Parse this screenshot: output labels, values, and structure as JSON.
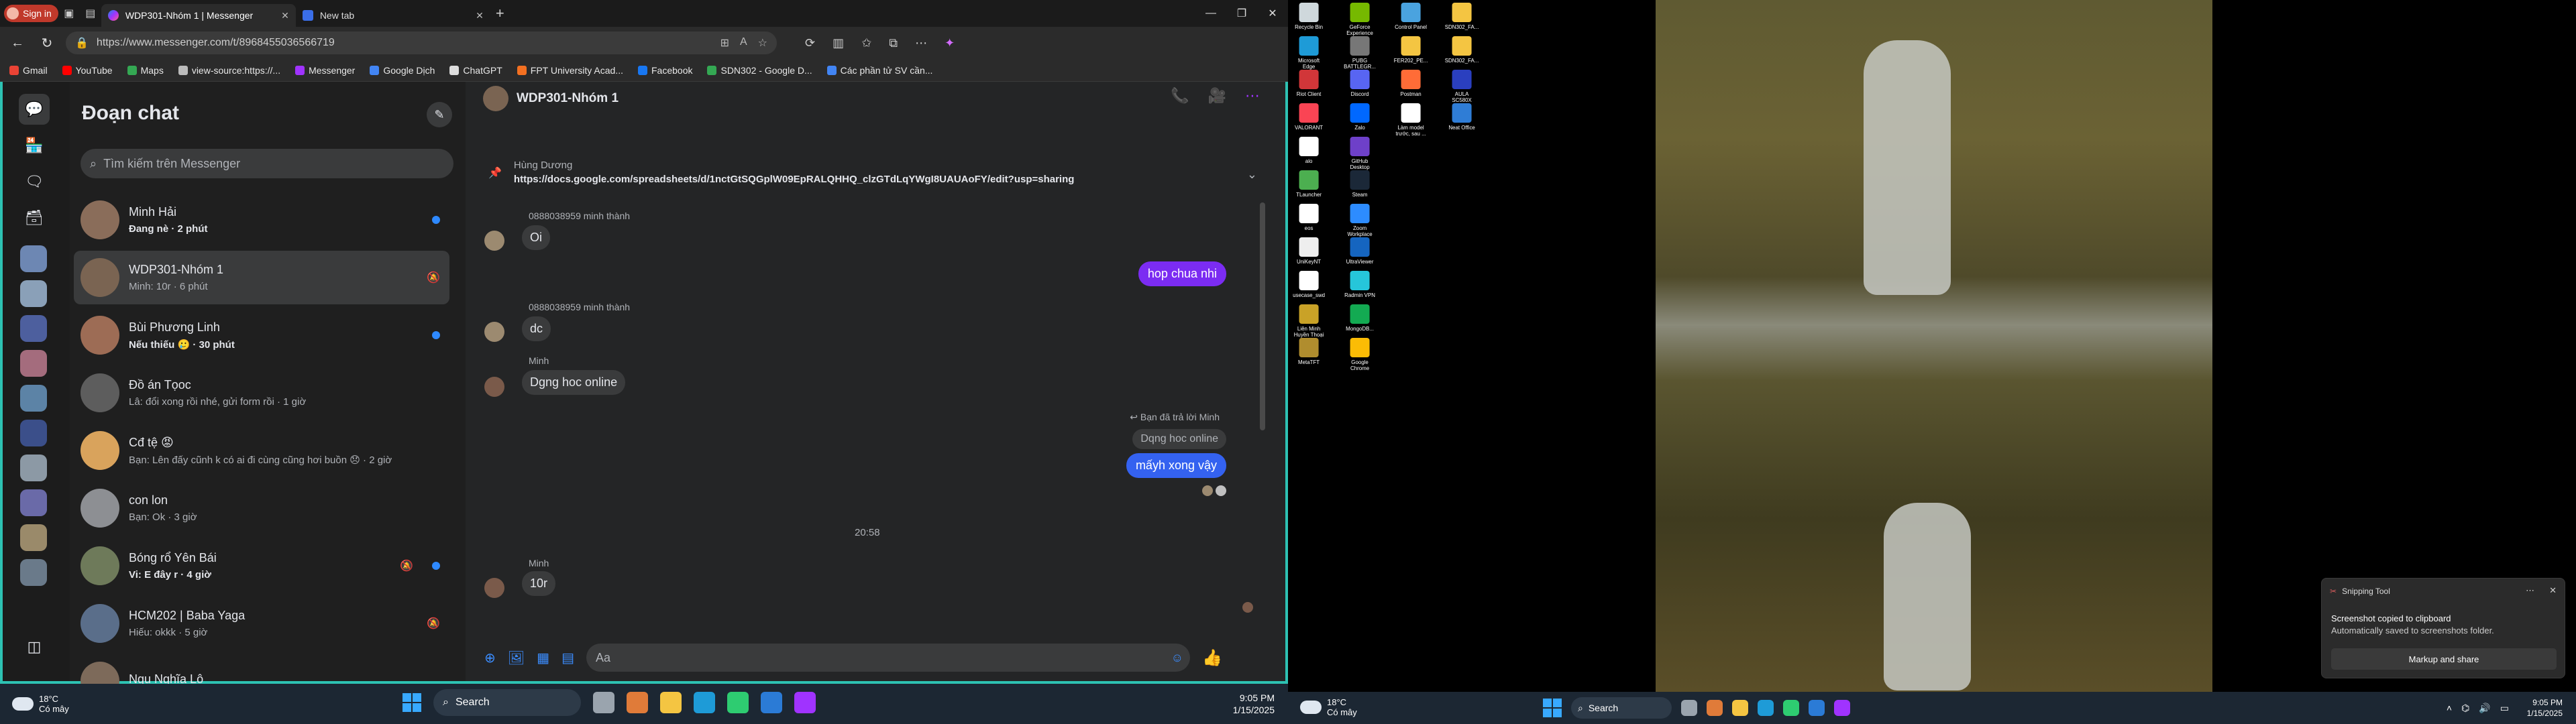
{
  "browser": {
    "profile_label": "Sign in",
    "tabs": [
      {
        "title": "WDP301-Nhóm 1 | Messenger"
      },
      {
        "title": "New tab"
      }
    ],
    "url": "https://www.messenger.com/t/8968455036566719",
    "bookmarks": [
      {
        "label": "Gmail",
        "color": "#ea4335"
      },
      {
        "label": "YouTube",
        "color": "#ff0000"
      },
      {
        "label": "Maps",
        "color": "#34a853"
      },
      {
        "label": "view-source:https://...",
        "color": "#bbbbbb"
      },
      {
        "label": "Messenger",
        "color": "#a033ff"
      },
      {
        "label": "Google Dịch",
        "color": "#4285f4"
      },
      {
        "label": "ChatGPT",
        "color": "#dddddd"
      },
      {
        "label": "FPT University Acad...",
        "color": "#f37021"
      },
      {
        "label": "Facebook",
        "color": "#1877f2"
      },
      {
        "label": "SDN302 - Google D...",
        "color": "#34a853"
      },
      {
        "label": "Các phần tử SV cần...",
        "color": "#4285f4"
      }
    ]
  },
  "sidebar": {
    "title": "Đoạn chat",
    "search_placeholder": "Tìm kiếm trên Messenger",
    "conversations": [
      {
        "name": "Minh Hải",
        "preview": "Đang nè · 2 phút",
        "unread": true,
        "avatar_color": "#8a6d5a"
      },
      {
        "name": "WDP301-Nhóm 1",
        "preview": "Minh: 10r · 6 phút",
        "selected": true,
        "muted": true,
        "avatar_color": "#7a6452"
      },
      {
        "name": "Bùi Phương Linh",
        "preview": "Nếu thiếu 🥲 · 30 phút",
        "unread": true,
        "avatar_color": "#9d6c55"
      },
      {
        "name": "Đồ án Tọoc",
        "preview": "Lâ: đổi xong rồi nhé, gửi form rồi · 1 giờ",
        "avatar_color": "#5d5d5d"
      },
      {
        "name": "Cđ tệ 😡",
        "preview": "Bạn: Lên đấy cũnh k có ai đi cùng cũng hơi buồn 😞 · 2 giờ",
        "avatar_color": "#d9a35c"
      },
      {
        "name": "con lon",
        "preview": "Bạn: Ok · 3 giờ",
        "avatar_color": "#8d8f93"
      },
      {
        "name": "Bóng rổ Yên Bái",
        "preview": "Vi: E đây r · 4 giờ",
        "unread": true,
        "muted": true,
        "avatar_color": "#6e7a5a"
      },
      {
        "name": "HCM202 | Baba Yaga",
        "preview": "Hiếu: okkk · 5 giờ",
        "muted": true,
        "avatar_color": "#5a6e8a"
      },
      {
        "name": "Ngu Nghĩa Lộ",
        "preview": "",
        "avatar_color": "#7d6a5a"
      }
    ]
  },
  "chat": {
    "title": "WDP301-Nhóm 1",
    "pinned": {
      "author": "Hùng Dương",
      "text": "https://docs.google.com/spreadsheets/d/1nctGtSQGplW09EpRALQHHQ_clzGTdLqYWgI8UAUAoFY/edit?usp=sharing"
    },
    "messages": {
      "s1": "0888038959 minh thành",
      "m1": "Oi",
      "out1": "hop chua nhi",
      "s2": "0888038959 minh thành",
      "m2": "dc",
      "s3": "Minh",
      "m3": "Dgng hoc online",
      "reply_note": "↩ Bạn đã trả lời Minh",
      "quoted": "Dqng hoc online",
      "out2": "mấyh xong vậy",
      "time": "20:58",
      "s4": "Minh",
      "m4": "10r"
    },
    "composer_placeholder": "Aa"
  },
  "taskbar": {
    "temp": "18°C",
    "weather": "Có mây",
    "search": "Search",
    "time": "9:05 PM",
    "date": "1/15/2025"
  },
  "desktop": {
    "icons": [
      {
        "label": "Recycle Bin",
        "color": "#cfd8dc"
      },
      {
        "label": "GeForce Experience",
        "color": "#76b900"
      },
      {
        "label": "Control Panel",
        "color": "#4aa3df"
      },
      {
        "label": "SDN302_FA...",
        "color": "#f4c542"
      },
      {
        "label": "Microsoft Edge",
        "color": "#1e9bd7"
      },
      {
        "label": "PUBG BATTLEGR...",
        "color": "#777777"
      },
      {
        "label": "FER202_PE...",
        "color": "#f4c542"
      },
      {
        "label": "SDN302_FA...",
        "color": "#f4c542"
      },
      {
        "label": "Riot Client",
        "color": "#d13639"
      },
      {
        "label": "Discord",
        "color": "#5865f2"
      },
      {
        "label": "Postman",
        "color": "#ff6c37"
      },
      {
        "label": "AULA SC580X",
        "color": "#2a3fbf"
      },
      {
        "label": "VALORANT",
        "color": "#fa4454"
      },
      {
        "label": "Zalo",
        "color": "#0068ff"
      },
      {
        "label": "Làm model trước, sau ...",
        "color": "#ffffff"
      },
      {
        "label": "Neat Office",
        "color": "#2f7dd6"
      },
      {
        "label": "alo",
        "color": "#ffffff"
      },
      {
        "label": "GitHub Desktop",
        "color": "#6e40c9"
      },
      {
        "label": "TLauncher",
        "color": "#4caf50"
      },
      {
        "label": "Steam",
        "color": "#1b2838"
      },
      {
        "label": "eos",
        "color": "#ffffff"
      },
      {
        "label": "Zoom Workplace",
        "color": "#2d8cff"
      },
      {
        "label": "UniKeyNT",
        "color": "#eeeeee"
      },
      {
        "label": "UltraViewer",
        "color": "#1565c0"
      },
      {
        "label": "usecase_swd",
        "color": "#ffffff"
      },
      {
        "label": "Radmin VPN",
        "color": "#26c6da"
      },
      {
        "label": "Liên Minh Huyền Thoại",
        "color": "#c9a227"
      },
      {
        "label": "MongoDB...",
        "color": "#13aa52"
      },
      {
        "label": "MetaTFT",
        "color": "#b08d2e"
      },
      {
        "label": "Google Chrome",
        "color": "#fbbc05"
      }
    ],
    "toast": {
      "app": "Snipping Tool",
      "line1": "Screenshot copied to clipboard",
      "line2": "Automatically saved to screenshots folder.",
      "button": "Markup and share"
    }
  }
}
